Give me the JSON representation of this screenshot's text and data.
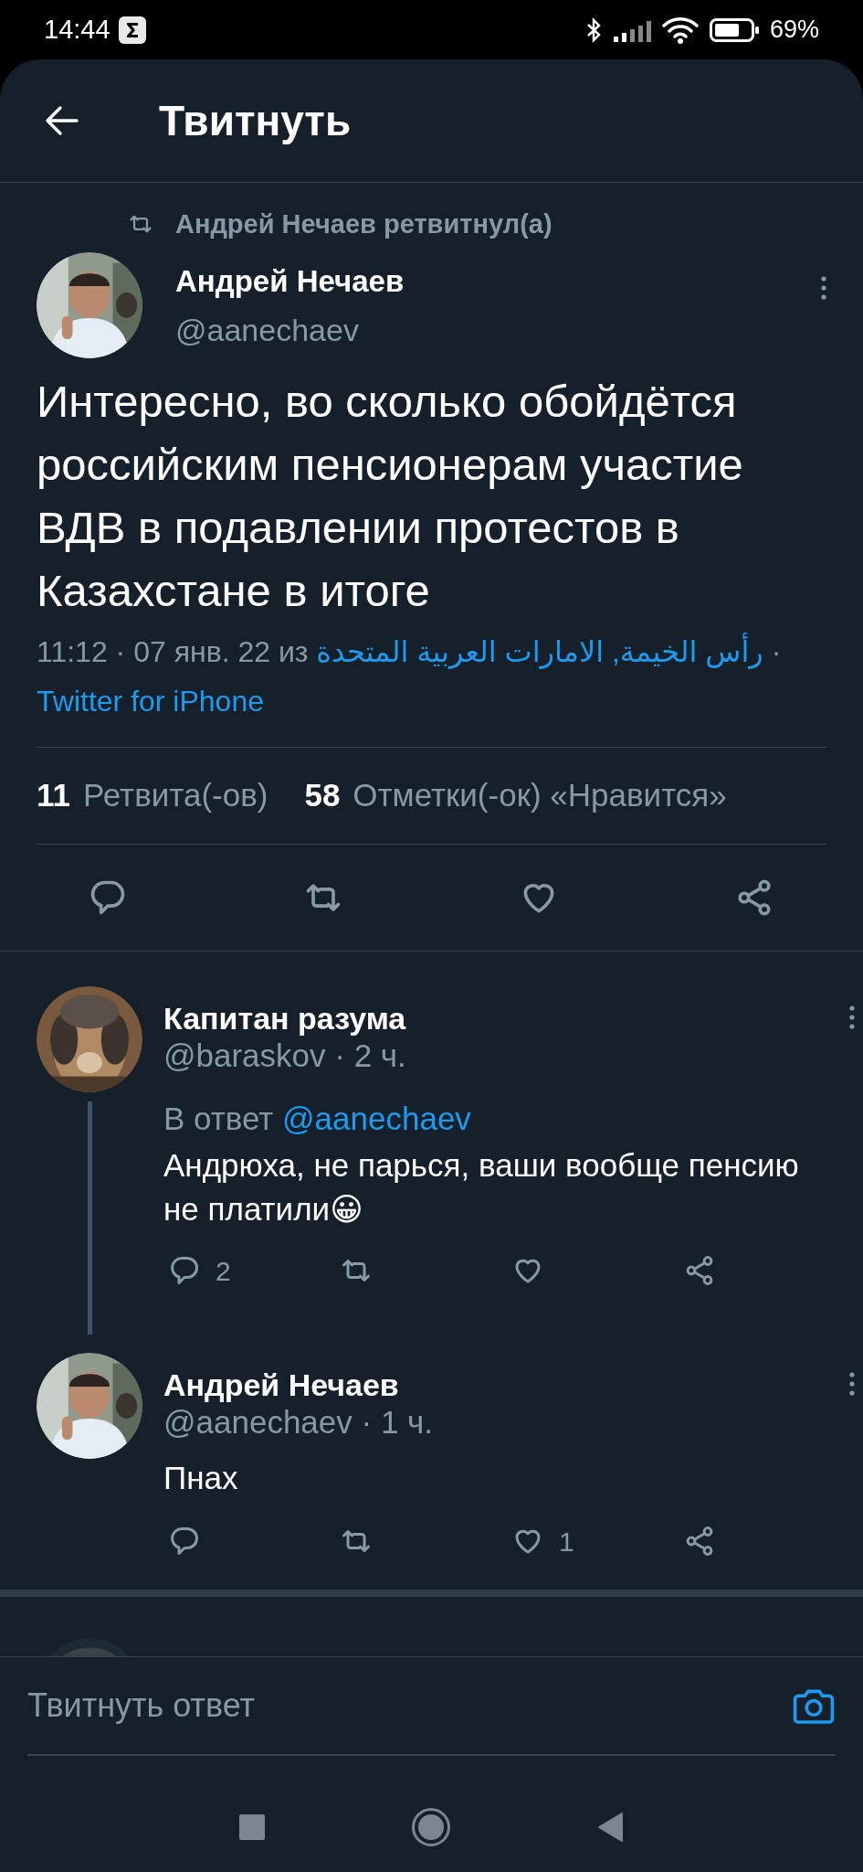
{
  "status_bar": {
    "time": "14:44",
    "battery": "69%"
  },
  "header": {
    "title": "Твитнуть"
  },
  "main_tweet": {
    "retweeted_by": "Андрей Нечаев ретвитнул(а)",
    "author": {
      "name": "Андрей Нечаев",
      "handle": "@aanechaev"
    },
    "text": "Интересно, во сколько обойдётся российским пенсионерам участие ВДВ в подавлении протестов в Казахстане в итоге",
    "meta": {
      "time": "11:12 · 07 янв. 22 из",
      "place": "رأس الخيمة, الامارات العربية المتحدة",
      "separator": "·",
      "source": "Twitter for iPhone"
    },
    "stats": [
      {
        "count": "11",
        "label": "Ретвита(-ов)"
      },
      {
        "count": "58",
        "label": "Отметки(-ок) «Нравится»"
      }
    ],
    "actions": [
      {
        "kind": "reply"
      },
      {
        "kind": "retweet"
      },
      {
        "kind": "like"
      },
      {
        "kind": "share"
      }
    ]
  },
  "replies": [
    {
      "name": "Капитан разума",
      "meta": "@baraskov · 2 ч.",
      "reply_to_label": "В ответ",
      "reply_to": "@aanechaev",
      "text": "Андрюха, не парься, ваши вообще пенсию не платили😀",
      "connected_below": true,
      "actions": [
        {
          "kind": "reply",
          "count": "2"
        },
        {
          "kind": "retweet"
        },
        {
          "kind": "like"
        },
        {
          "kind": "share"
        }
      ]
    },
    {
      "name": "Андрей Нечаев",
      "meta": "@aanechaev · 1 ч.",
      "text": "Пнах",
      "connected_below": false,
      "actions": [
        {
          "kind": "reply"
        },
        {
          "kind": "retweet"
        },
        {
          "kind": "like",
          "count": "1"
        },
        {
          "kind": "share"
        }
      ]
    }
  ],
  "compose": {
    "placeholder": "Твитнуть ответ"
  }
}
